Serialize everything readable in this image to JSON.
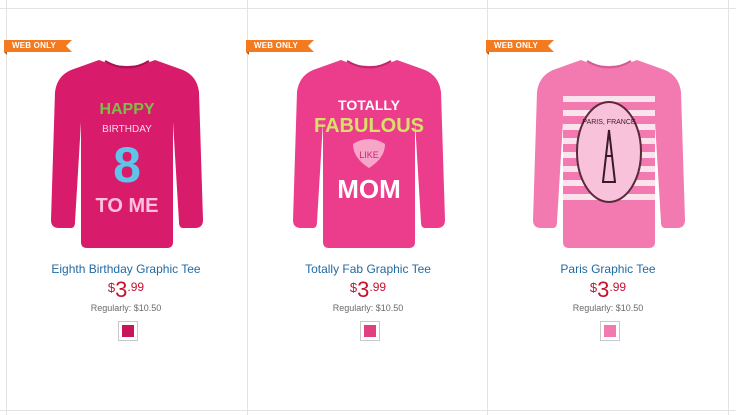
{
  "products": [
    {
      "badge": "WEB ONLY",
      "name": "Eighth Birthday Graphic Tee",
      "currency": "$",
      "price_dollars": "3",
      "price_cents": ".99",
      "regular_price": "Regularly: $10.50",
      "shirt_color": "#d81b6b",
      "swatch_color": "#c8145a",
      "graphic_lines": [
        "HAPPY",
        "BIRTHDAY",
        "8",
        "TO ME"
      ]
    },
    {
      "badge": "WEB ONLY",
      "name": "Totally Fab Graphic Tee",
      "currency": "$",
      "price_dollars": "3",
      "price_cents": ".99",
      "regular_price": "Regularly: $10.50",
      "shirt_color": "#ec3d8c",
      "swatch_color": "#e0407f",
      "graphic_lines": [
        "TOTALLY",
        "FABULOUS",
        "LIKE",
        "MOM"
      ]
    },
    {
      "badge": "WEB ONLY",
      "name": "Paris Graphic Tee",
      "currency": "$",
      "price_dollars": "3",
      "price_cents": ".99",
      "regular_price": "Regularly: $10.50",
      "shirt_color": "#f27ab1",
      "swatch_color": "#f07ab0",
      "graphic_lines": [
        "PARIS, FRANCE"
      ]
    }
  ],
  "icons": {
    "shirt": "long-sleeve-tee-icon"
  }
}
